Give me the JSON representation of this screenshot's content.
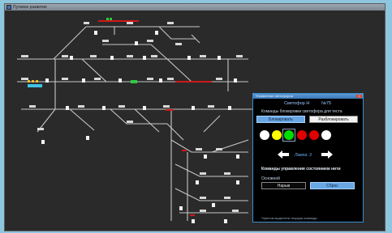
{
  "window": {
    "title": "Путевое развитие"
  },
  "panel": {
    "title": "Управление светофором",
    "header_left": "Светофор Н",
    "header_right": "№75",
    "block_section_label": "Команды блокировки светофора для теста",
    "block_button": "Блокировать",
    "unblock_button": "Разблокировать",
    "lamps": [
      "#ffffff",
      "#ffff00",
      "#00dd00",
      "#e00000",
      "#e00000",
      "#ffffff"
    ],
    "lamp_label": "Лампа: 3",
    "filament_section_label": "Команды управления состоянием нити",
    "mode_label": "Основной",
    "break_button": "Нарыв",
    "reset_button": "Сброс",
    "footnote": "*Цветом выделена текущая команда"
  }
}
